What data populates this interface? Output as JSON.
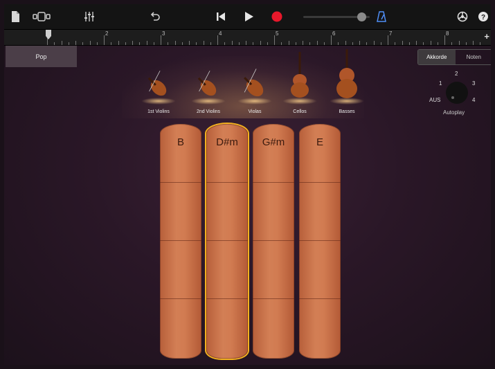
{
  "toolbar": {
    "icons": [
      "document-icon",
      "view-toggle-icon",
      "mixer-icon",
      "undo-icon",
      "skip-back-icon",
      "play-icon",
      "record-icon",
      "master-volume-slider",
      "metronome-icon",
      "settings-icon",
      "help-icon"
    ],
    "colors": {
      "record": "#e8182b",
      "metronome": "#4f8ef7",
      "background": "#141414"
    },
    "volume_level": 0.88
  },
  "ruler": {
    "bars": [
      "2",
      "3",
      "4",
      "5",
      "6",
      "7",
      "8"
    ],
    "add_label": "+"
  },
  "style_preset": "Pop",
  "view_mode": {
    "options": [
      "Akkorde",
      "Noten"
    ],
    "selected": "Akkorde"
  },
  "autoplay": {
    "label": "Autoplay",
    "off_label": "AUS",
    "positions": [
      "1",
      "2",
      "3",
      "4"
    ]
  },
  "instruments": [
    {
      "name": "1st Violins"
    },
    {
      "name": "2nd Violins"
    },
    {
      "name": "Violas"
    },
    {
      "name": "Cellos"
    },
    {
      "name": "Basses"
    }
  ],
  "chords": [
    {
      "name": "B",
      "selected": false
    },
    {
      "name": "D#m",
      "selected": true
    },
    {
      "name": "G#m",
      "selected": false
    },
    {
      "name": "E",
      "selected": false
    }
  ],
  "colors": {
    "strip": "#cf7a50",
    "selected_outline": "#f4b11f"
  }
}
